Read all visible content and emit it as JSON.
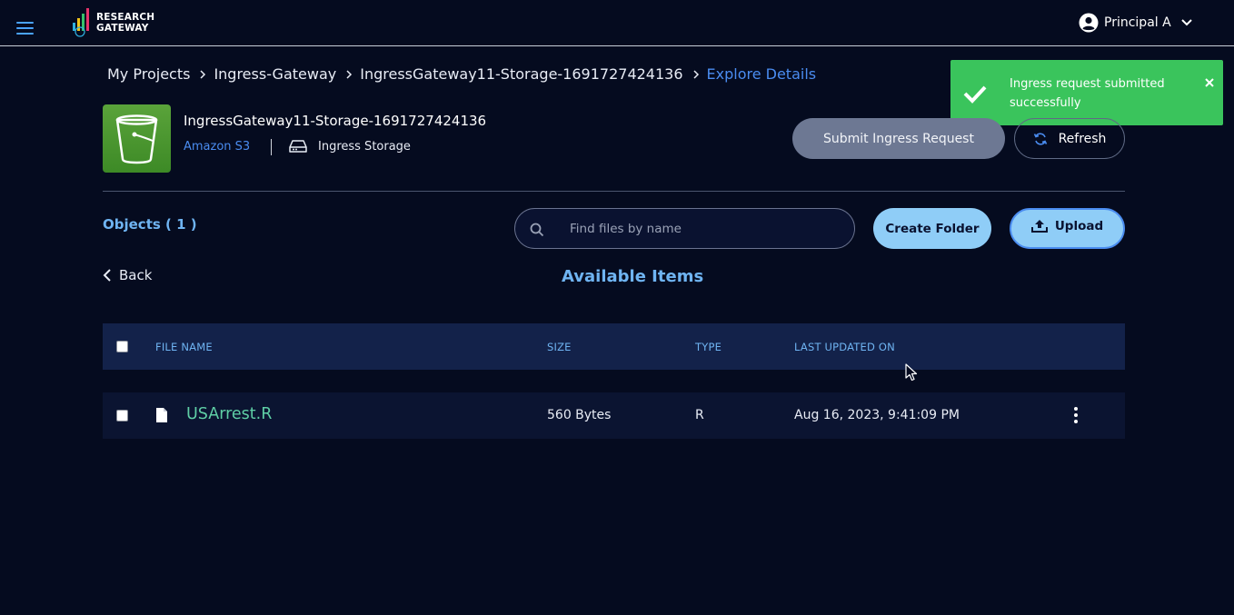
{
  "header": {
    "logo_line1": "RESEARCH",
    "logo_line2": "GATEWAY",
    "user_name": "Principal A"
  },
  "breadcrumb": {
    "items": [
      "My Projects",
      "Ingress-Gateway",
      "IngressGateway11-Storage-1691727424136"
    ],
    "current": "Explore Details"
  },
  "toast": {
    "message": "Ingress request submitted successfully",
    "color": "#3ac45c"
  },
  "resource": {
    "name": "IngressGateway11-Storage-1691727424136",
    "provider": "Amazon S3",
    "storage_type": "Ingress Storage",
    "icon": "s3-bucket-icon"
  },
  "actions": {
    "submit_ingress": "Submit Ingress Request",
    "refresh": "Refresh",
    "create_folder": "Create Folder",
    "upload": "Upload"
  },
  "objects": {
    "count_label": "Objects ( 1 )"
  },
  "search": {
    "placeholder": "Find files by name",
    "value": ""
  },
  "nav": {
    "back": "Back",
    "section_title": "Available Items"
  },
  "table": {
    "columns": [
      "FILE NAME",
      "SIZE",
      "TYPE",
      "LAST UPDATED ON"
    ],
    "rows": [
      {
        "name": "USArrest.R",
        "size": "560 Bytes",
        "type": "R",
        "updated": "Aug 16, 2023, 9:41:09 PM"
      }
    ]
  },
  "colors": {
    "background": "#050b1f",
    "accent_blue": "#4a8cf0",
    "light_blue": "#8fcdf7",
    "heading_blue": "#6fb4f2",
    "file_link": "#5fcfa6"
  }
}
